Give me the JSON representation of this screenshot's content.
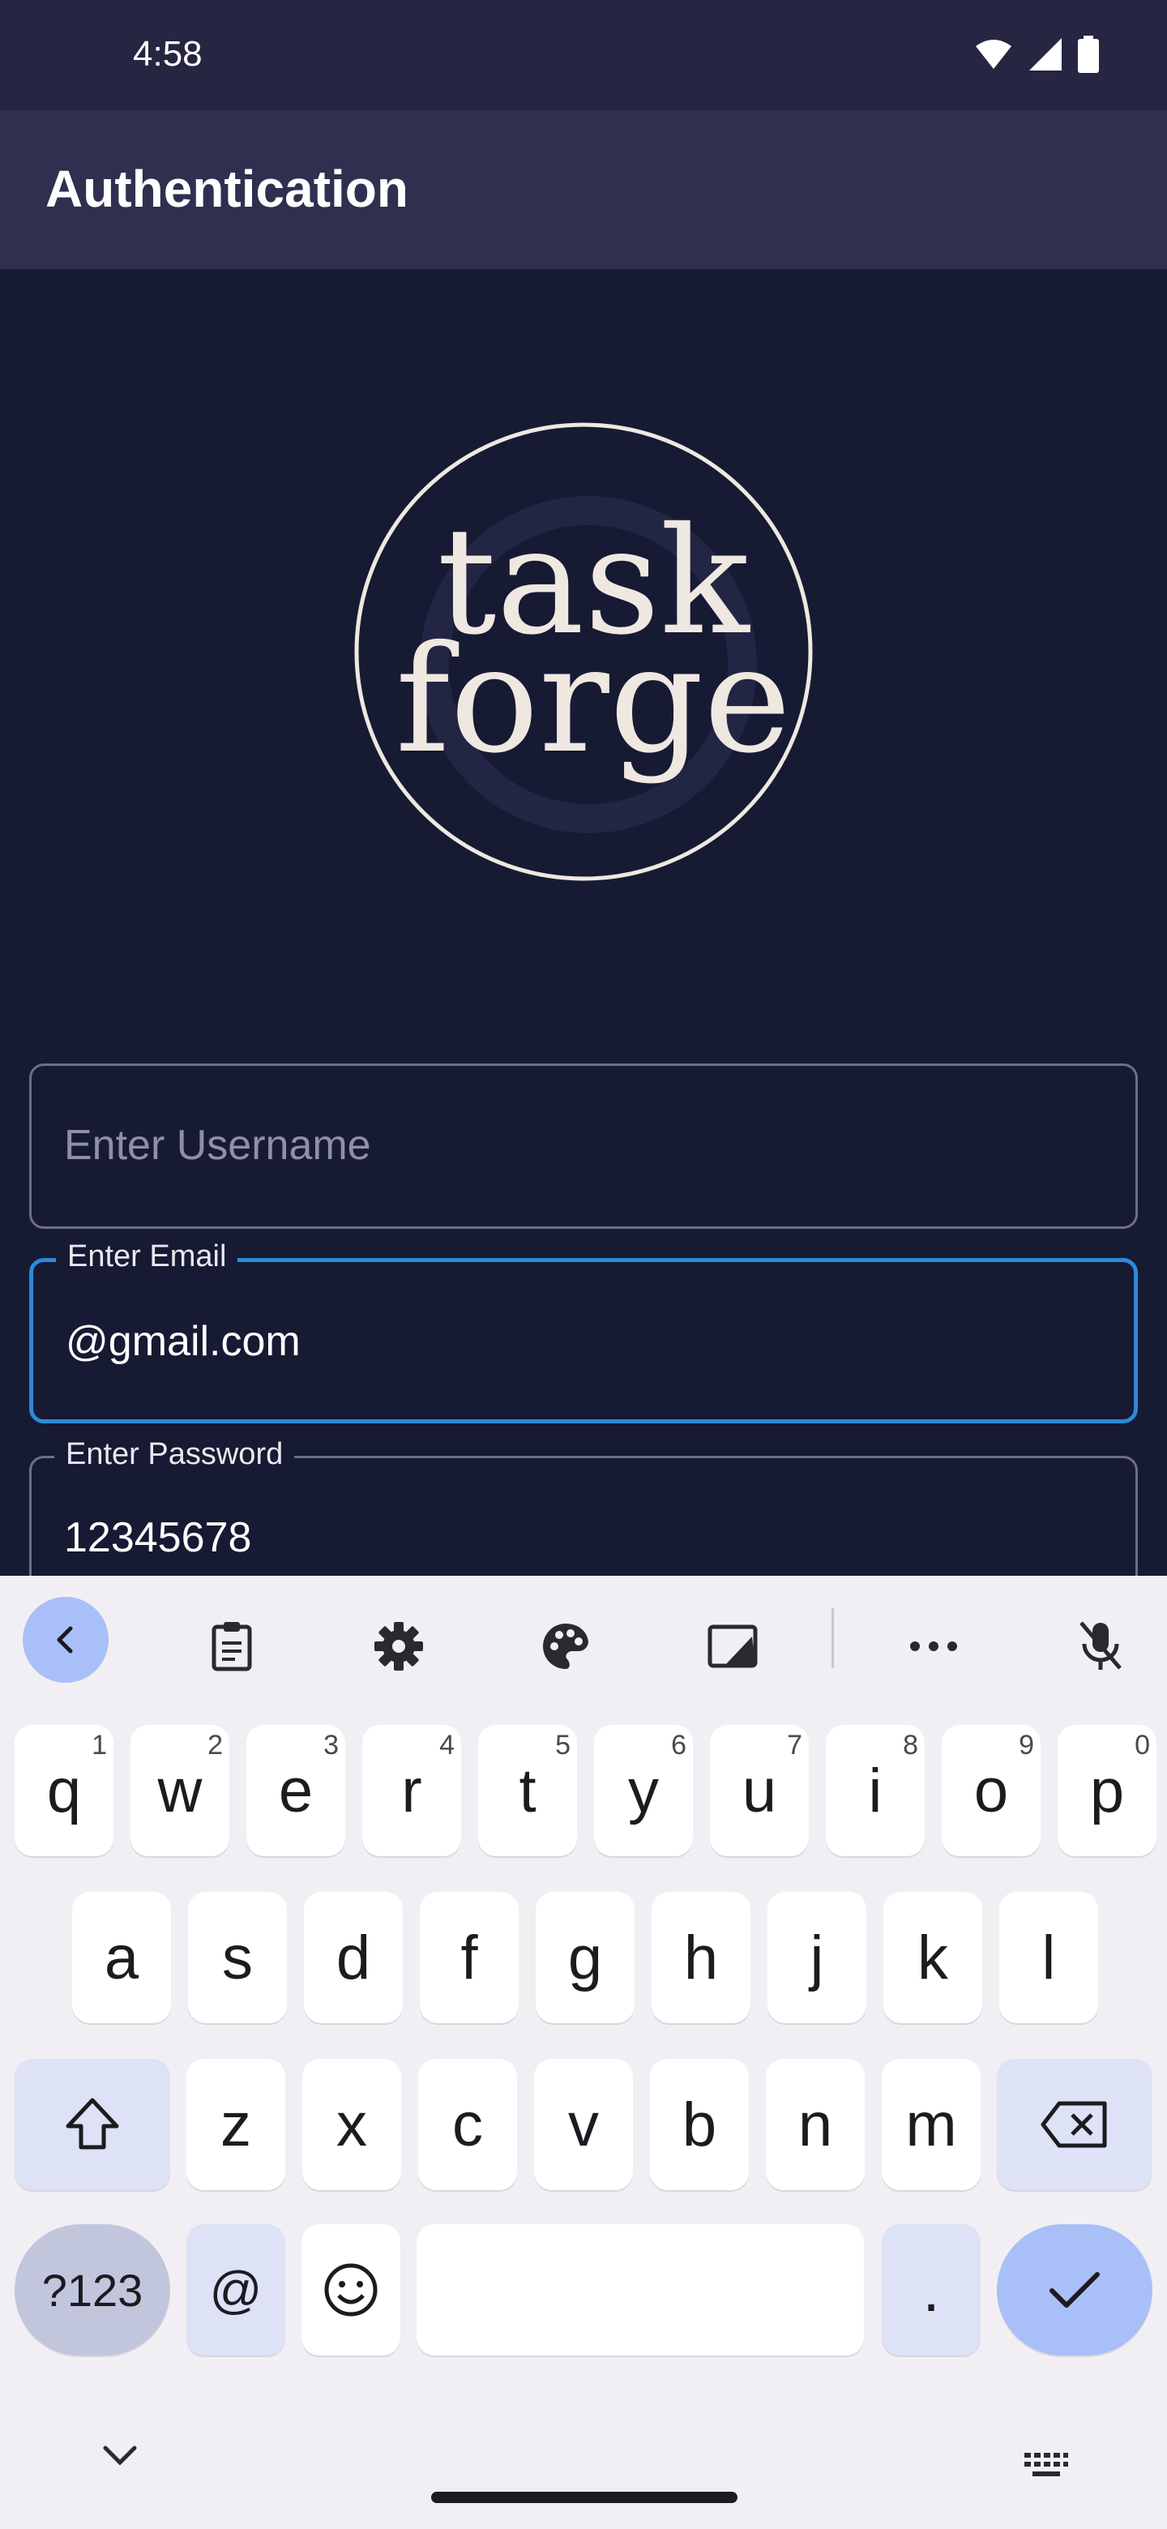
{
  "status_bar": {
    "time": "4:58",
    "icons": [
      "wifi-icon",
      "signal-icon",
      "battery-icon"
    ]
  },
  "app_bar": {
    "title": "Authentication"
  },
  "logo": {
    "line1": "task",
    "line2": "forge"
  },
  "form": {
    "username": {
      "placeholder": "Enter Username",
      "value": ""
    },
    "email": {
      "label": "Enter Email",
      "value": "@gmail.com"
    },
    "password": {
      "label": "Enter Password",
      "value": "12345678"
    }
  },
  "keyboard": {
    "toolbar_icons": [
      "back-icon",
      "clipboard-icon",
      "settings-icon",
      "palette-icon",
      "edit-icon",
      "more-icon",
      "mic-off-icon"
    ],
    "row1": [
      {
        "k": "q",
        "h": "1"
      },
      {
        "k": "w",
        "h": "2"
      },
      {
        "k": "e",
        "h": "3"
      },
      {
        "k": "r",
        "h": "4"
      },
      {
        "k": "t",
        "h": "5"
      },
      {
        "k": "y",
        "h": "6"
      },
      {
        "k": "u",
        "h": "7"
      },
      {
        "k": "i",
        "h": "8"
      },
      {
        "k": "o",
        "h": "9"
      },
      {
        "k": "p",
        "h": "0"
      }
    ],
    "row2": [
      "a",
      "s",
      "d",
      "f",
      "g",
      "h",
      "j",
      "k",
      "l"
    ],
    "row3": [
      "z",
      "x",
      "c",
      "v",
      "b",
      "n",
      "m"
    ],
    "sym_label": "?123",
    "at_label": "@",
    "period_label": ".",
    "colors": {
      "accent": "#a9bff7",
      "focus": "#2c8ad8",
      "background": "#171a33"
    }
  }
}
